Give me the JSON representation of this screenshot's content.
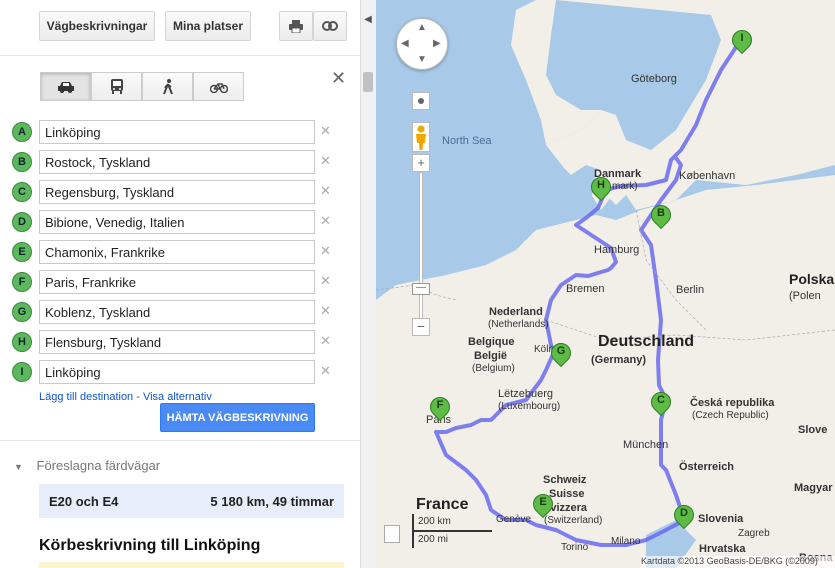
{
  "toolbar": {
    "directions_button": "Vägbeskrivningar",
    "my_places_button": "Mina platser",
    "print_icon": "print-icon",
    "link_icon": "link-icon"
  },
  "travel_modes": [
    "car-icon",
    "bus-icon",
    "walk-icon",
    "bike-icon"
  ],
  "waypoints": [
    {
      "letter": "A",
      "value": "Linköping"
    },
    {
      "letter": "B",
      "value": "Rostock, Tyskland"
    },
    {
      "letter": "C",
      "value": "Regensburg, Tyskland"
    },
    {
      "letter": "D",
      "value": "Bibione, Venedig, Italien"
    },
    {
      "letter": "E",
      "value": "Chamonix, Frankrike"
    },
    {
      "letter": "F",
      "value": "Paris, Frankrike"
    },
    {
      "letter": "G",
      "value": "Koblenz, Tyskland"
    },
    {
      "letter": "H",
      "value": "Flensburg, Tyskland"
    },
    {
      "letter": "I",
      "value": "Linköping"
    }
  ],
  "links": {
    "add_destination": "Lägg till destination",
    "separator": " - ",
    "show_options": "Visa alternativ"
  },
  "get_directions_button": "HÄMTA VÄGBESKRIVNING",
  "suggested": {
    "title": "Föreslagna färdvägar",
    "route": {
      "name": "E20 och E4",
      "summary": "5 180 km, 49 timmar"
    }
  },
  "driving_title": "Körbeskrivning till Linköping",
  "map": {
    "labels": {
      "goteborg": "Göteborg",
      "north_sea": "North Sea",
      "danmark": "Danmark",
      "danmark_sub": "mark)",
      "kobenhavn": "København",
      "hamburg": "Hamburg",
      "bremen": "Bremen",
      "berlin": "Berlin",
      "polska": "Polska",
      "polska_sub": "(Polen",
      "nederland": "Nederland",
      "nederland_sub": "(Netherlands)",
      "deutschland": "Deutschland",
      "deutschland_sub": "(Germany)",
      "belgie": "Belgique",
      "belgie2": "België",
      "belgie_sub": "(Belgium)",
      "koln": "Köln",
      "letzebuerg": "Lëtzebuerg",
      "letzebuerg_sub": "(Luxembourg)",
      "ceska": "Česká republika",
      "ceska_sub": "(Czech Republic)",
      "paris": "Paris",
      "munchen": "München",
      "osterreich": "Österreich",
      "schweiz": "Schweiz",
      "suisse": "Suisse",
      "svizzera": "Svizzera",
      "svizzera_sub": "(Switzerland)",
      "france": "France",
      "geneve": "Genève",
      "torino": "Torino",
      "milano": "Milano",
      "slovenia": "Slovenia",
      "hrvatska": "Hrvatska",
      "magyar": "Magyar",
      "slove": "Slove",
      "zagreb": "Zagreb",
      "bosna": "Bosna i"
    },
    "scale": {
      "km": "200 km",
      "mi": "200 mi"
    },
    "attribution": "Kartdata ©2013 GeoBasis-DE/BKG (©2009)",
    "colors": {
      "route": "#6a6aee",
      "land": "#f2efe9",
      "water": "#a8c9e8",
      "marker": "#5dbb46"
    }
  }
}
